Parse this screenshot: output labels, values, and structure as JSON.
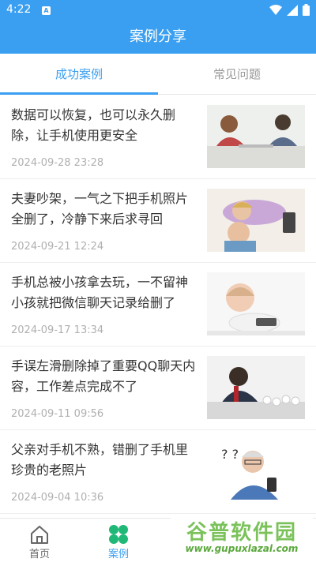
{
  "status_bar": {
    "time": "4:22",
    "notification_icon": "A",
    "icons": [
      "wifi-icon",
      "signal-icon",
      "battery-icon"
    ]
  },
  "app_bar": {
    "title": "案例分享"
  },
  "tabs": [
    {
      "label": "成功案例",
      "active": true
    },
    {
      "label": "常见问题",
      "active": false
    }
  ],
  "cases": [
    {
      "title": "数据可以恢复，也可以永久删除，让手机使用更安全",
      "date": "2024-09-28 23:28",
      "thumb": "couple-table-image"
    },
    {
      "title": "夫妻吵架，一气之下把手机照片全删了，冷静下来后求寻回",
      "date": "2024-09-21 12:24",
      "thumb": "couple-phone-image"
    },
    {
      "title": "手机总被小孩拿去玩，一不留神小孩就把微信聊天记录给删了",
      "date": "2024-09-17 13:34",
      "thumb": "baby-phone-image"
    },
    {
      "title": "手误左滑删除掉了重要QQ聊天内容，工作差点完成不了",
      "date": "2024-09-11 09:56",
      "thumb": "stressed-worker-image"
    },
    {
      "title": "父亲对手机不熟，错删了手机里珍贵的老照片",
      "date": "2024-09-04 10:36",
      "thumb": "confused-elder-image"
    }
  ],
  "bottom_nav": [
    {
      "label": "首页",
      "icon": "home-icon",
      "active": false
    },
    {
      "label": "案例",
      "icon": "cases-grid-icon",
      "active": true
    }
  ],
  "watermark": {
    "title": "谷普软件园",
    "url": "www.gupuxlazal.com"
  },
  "colors": {
    "primary": "#3a9ff0",
    "active_nav": "#20b877"
  }
}
